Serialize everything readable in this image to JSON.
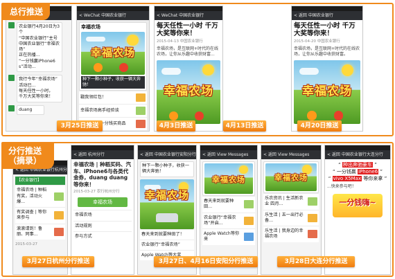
{
  "sections": {
    "top": {
      "tag": "总行推送"
    },
    "bottom": {
      "tag": "分行推送（摘录）"
    }
  },
  "top_phones": [
    {
      "navbar": "...  中国农业银行",
      "lines": [
        "农业银行4月20日为3个",
        "“中国农业银行”主号",
        "中国农业银行“幸福农场”",
        "正在热播...",
        "“一分钱赢iPhone6",
        "s”活动..."
      ],
      "lines2": [
        "我行今年“幸福农场”",
        "活动已...",
        "每天任性一小时，",
        "千万大奖等你来！"
      ],
      "chat": [
        "duang"
      ],
      "date_badge": "3月25日推送"
    },
    {
      "navbar": "< WeChat  中国农业银行",
      "card_title": "幸福农场",
      "card_caption": "种下一颗小种子，收获一辆大奔驰！",
      "items": [
        "戳我领红包！",
        "幸福农场高手经验谈",
        "生活e站 | 一分钱买商品"
      ],
      "date_badge": "4月3日推送"
    },
    {
      "navbar": "< WeChat  中国农业银行",
      "title": "每天任性一小时 千万大奖等你来！",
      "meta": "2015-04-13  中国农业银行",
      "text": "幸福农场，是互联网+时代的在线农场，让你从乐趣中收获财富...",
      "date_badge": "4月13日推送"
    },
    {
      "navbar": "< 返回  中国农业银行",
      "title": "每天任性一小时 千万大奖等你来！",
      "meta": "2015-04-20  中国农业银行",
      "text": "幸福农场，是互联网+时代的在线农场，让你从乐趣中收获财富。",
      "date_badge": "4月20日推送"
    }
  ],
  "bottom_phones": [
    {
      "navbar": "< 返回  中国农业银行杭州分行",
      "header": "【农业银行】",
      "items": [
        "幸福农场 | 种稻有奖，活动火爆...",
        "有奖调查 | 等你来参与",
        "滚滚请到！鲁丽、同事..."
      ],
      "footer": "2015-03-27"
    },
    {
      "navbar": "< 返回  杭州分行",
      "title_prefix": "幸福农场 | 种稻买码、汽车、",
      "title_highlight": "iPhone6",
      "title_suffix": "与各类代金券，duang duang等你来！",
      "meta": "2015-03-27  农行杭州分行",
      "button": "幸福农场",
      "list": [
        "幸福农场",
        "活动规则",
        "参与方式"
      ]
    },
    {
      "navbar": "< 返回  中国农业银行安阳分行",
      "text": "种下一颗小种子，收获一辆大奔驰！",
      "items": [
        "春天来到就要种田了！",
        "农业银行“幸福农场”",
        "Apple Watch等大奖"
      ]
    },
    {
      "navbar": "< 返回  View Messages",
      "items": [
        "春天来到就要种田...",
        "农业银行“幸福农场”开启...",
        "Apple Watch等你来"
      ]
    },
    {
      "navbar": "< 返回  View Messages",
      "items": [
        "乐农资讯 | 生活新农业 四月...",
        "乐生活 | 五一出行必备...",
        "乐生活 | 我身边的幸福农场"
      ]
    },
    {
      "navbar": "< 返回  中国农业银行大连分行",
      "line1_prefix": "“ ",
      "line1_red": "种出奔驰豪车",
      "line1_suffix": " ”",
      "line2_prefix": "“ 一分钱赢 ",
      "line2_red": "iPhone6",
      "line2_suffix": " ”",
      "line3_prefix": "“ ",
      "line3_red": "vivo X5Max",
      "line3_suffix": " 等你来拿 ”",
      "text": "...快来参与吧！",
      "promo": "一分钱嗨~"
    }
  ],
  "bottom_badges": {
    "b1": "3月27日杭州分行推送",
    "b2": "3月27日、4月16日安阳分行推送",
    "b3": "3月28日大连分行推送"
  },
  "farm_logo": "幸福农场"
}
